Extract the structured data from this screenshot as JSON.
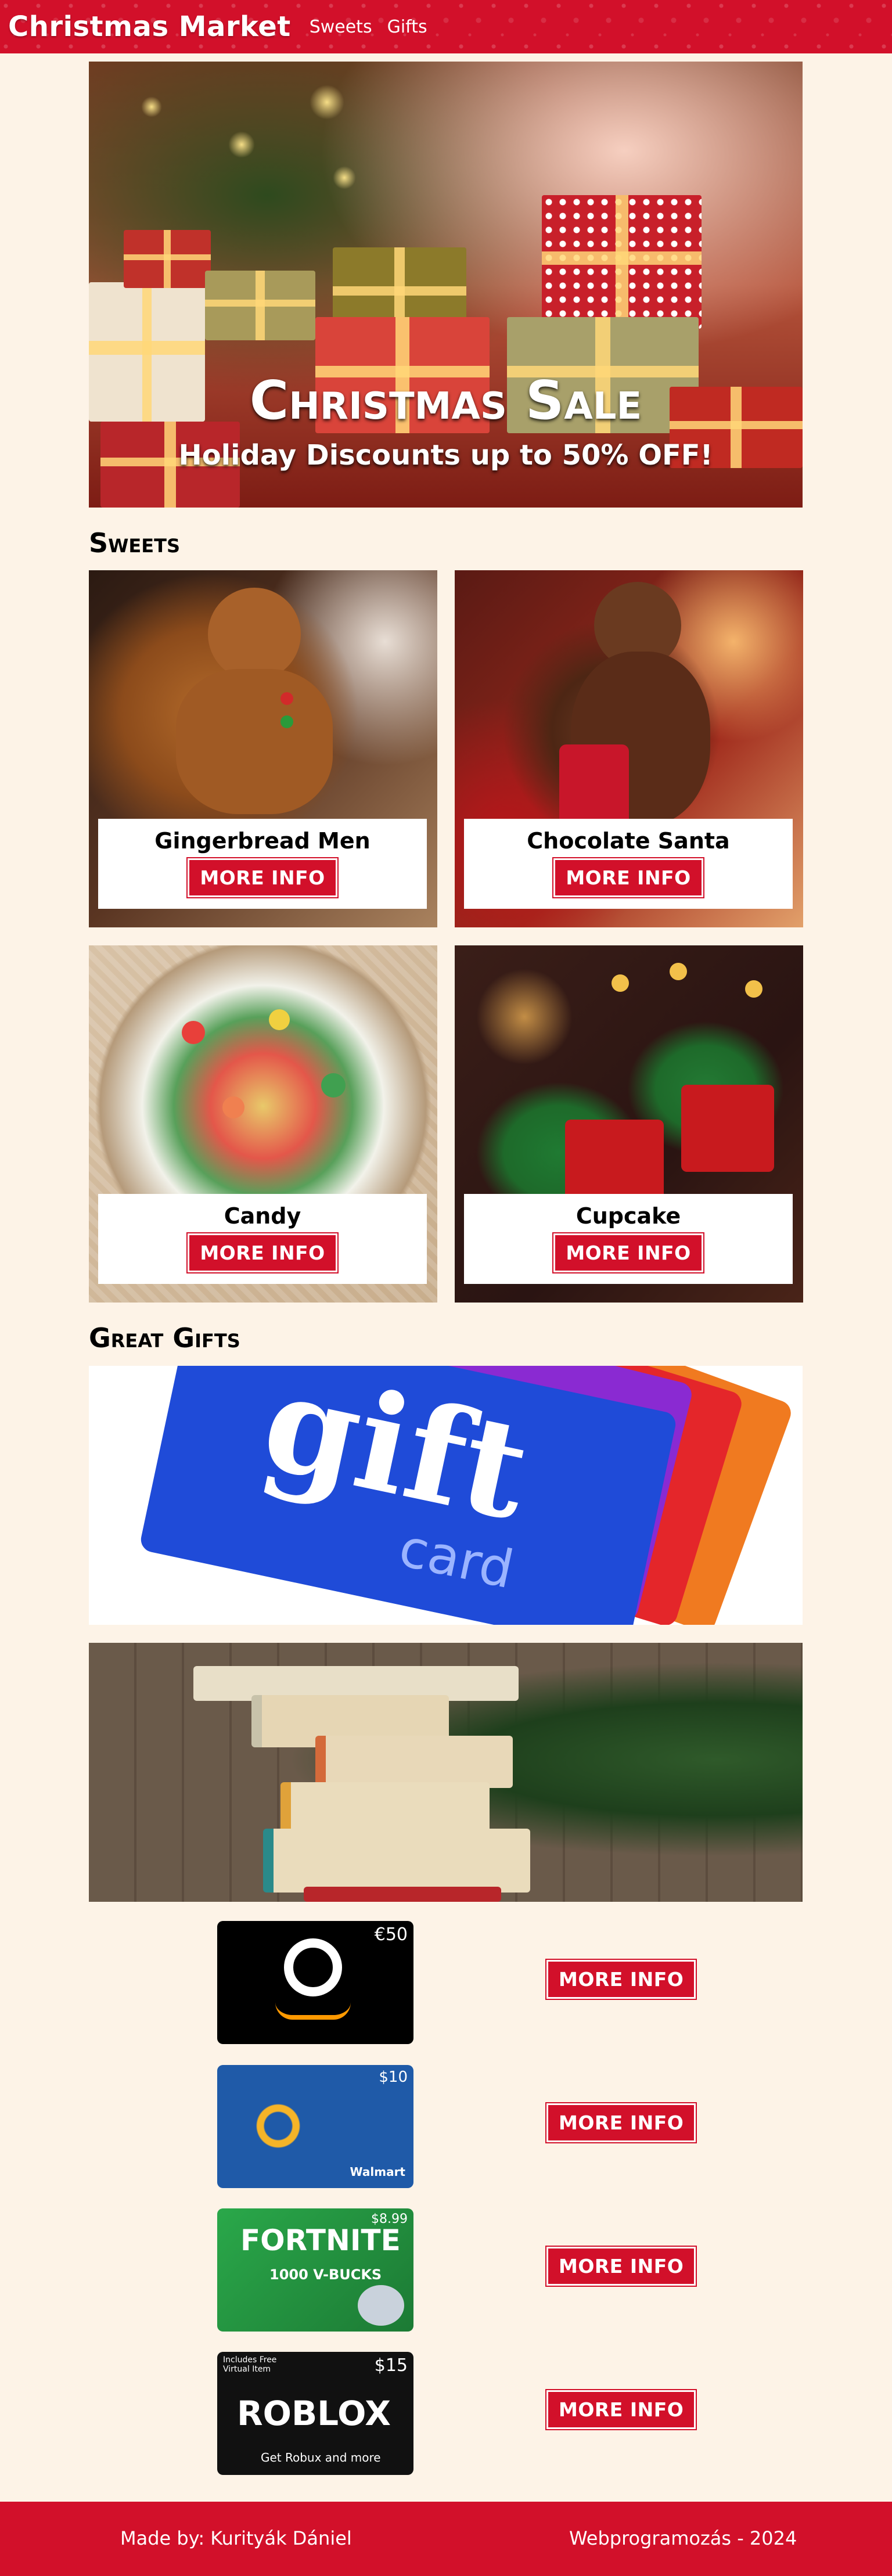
{
  "header": {
    "brand": "Christmas Market",
    "nav": [
      "Sweets",
      "Gifts"
    ]
  },
  "hero": {
    "title": "Christmas Sale",
    "subtitle": "Holiday Discounts up to 50% OFF!"
  },
  "sweets": {
    "heading": "Sweets",
    "items": [
      {
        "name": "Gingerbread Men",
        "button": "MORE INFO"
      },
      {
        "name": "Chocolate Santa",
        "button": "MORE INFO"
      },
      {
        "name": "Candy",
        "button": "MORE INFO"
      },
      {
        "name": "Cupcake",
        "button": "MORE INFO"
      }
    ]
  },
  "gifts": {
    "heading": "Great Gifts",
    "banner_text": {
      "big": "gift",
      "small": "card"
    },
    "cards": [
      {
        "brand": "amazon",
        "price": "€50",
        "button": "MORE INFO"
      },
      {
        "brand": "Walmart",
        "price": "$10",
        "button": "MORE INFO"
      },
      {
        "brand": "FORTNITE",
        "subtitle": "1000 V-BUCKS",
        "price": "$8.99",
        "button": "MORE INFO"
      },
      {
        "brand": "ROBLOX",
        "subtitle": "Get Robux and more",
        "note": "Includes Free Virtual Item",
        "price": "$15",
        "button": "MORE INFO"
      }
    ]
  },
  "footer": {
    "made_by": "Made by: Kurityák Dániel",
    "course": "Webprogramozás - 2024"
  },
  "colors": {
    "accent": "#d2102a",
    "page_bg": "#fdf3e7"
  }
}
